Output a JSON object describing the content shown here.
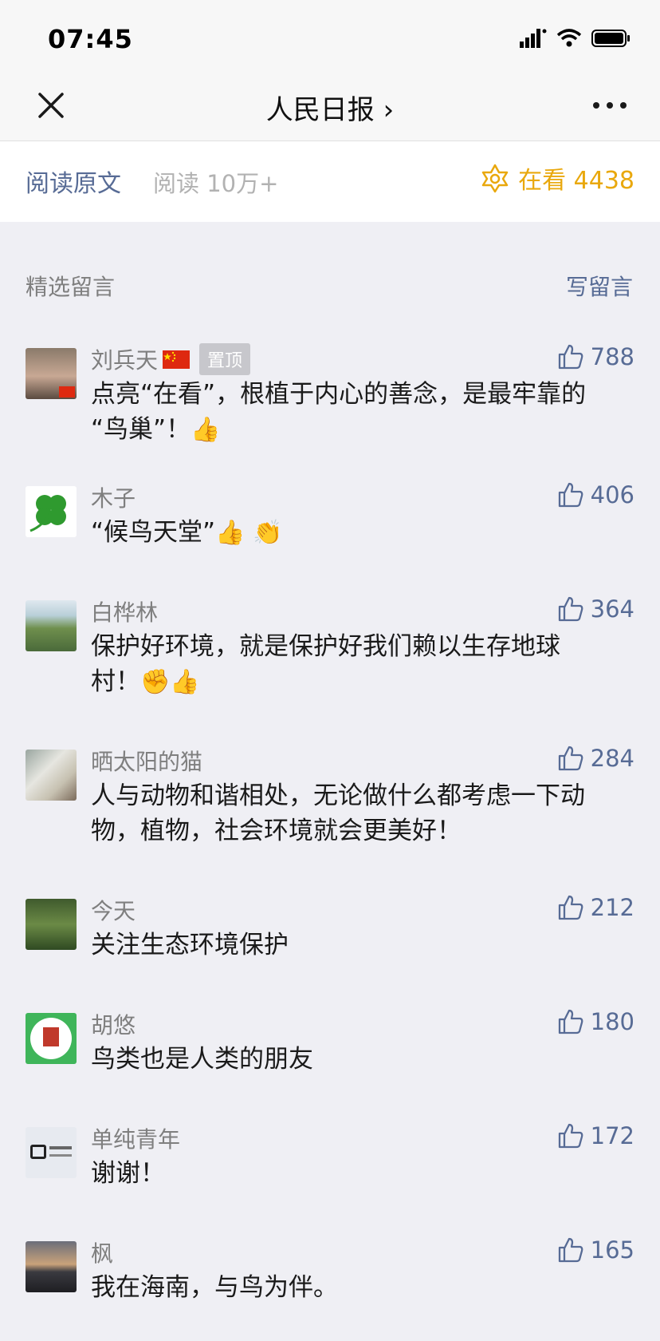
{
  "status": {
    "time": "07:45"
  },
  "nav": {
    "title": "人民日报 ›",
    "close_icon": "close-icon",
    "more_icon": "more-icon"
  },
  "read": {
    "original": "阅读原文",
    "count": "阅读 10万+",
    "zaikan": "在看 4438",
    "accent": "#e9a80d",
    "link_color": "#576b95"
  },
  "section": {
    "title": "精选留言",
    "write": "写留言"
  },
  "comments": [
    {
      "name": "刘兵天",
      "pinned": "置顶",
      "likes": "788",
      "text": "点亮“在看”，根植于内心的善念，是最牢靠的\n“鸟巢”！",
      "emoji": "👍"
    },
    {
      "name": "木子",
      "likes": "406",
      "text": "“候鸟天堂”",
      "emoji": "👍 👏"
    },
    {
      "name": "白桦林",
      "likes": "364",
      "text": "保护好环境，就是保护好我们赖以生存地球\n村！",
      "emoji": "✊👍"
    },
    {
      "name": "晒太阳的猫",
      "likes": "284",
      "text": "人与动物和谐相处，无论做什么都考虑一下动\n物，植物，社会环境就会更美好！",
      "emoji": ""
    },
    {
      "name": "今天",
      "likes": "212",
      "text": "关注生态环境保护",
      "emoji": ""
    },
    {
      "name": "胡悠",
      "likes": "180",
      "text": "鸟类也是人类的朋友",
      "emoji": ""
    },
    {
      "name": "单纯青年",
      "likes": "172",
      "text": "谢谢！",
      "emoji": ""
    },
    {
      "name": "枫",
      "likes": "165",
      "text": "我在海南，与鸟为伴。",
      "emoji": ""
    }
  ]
}
